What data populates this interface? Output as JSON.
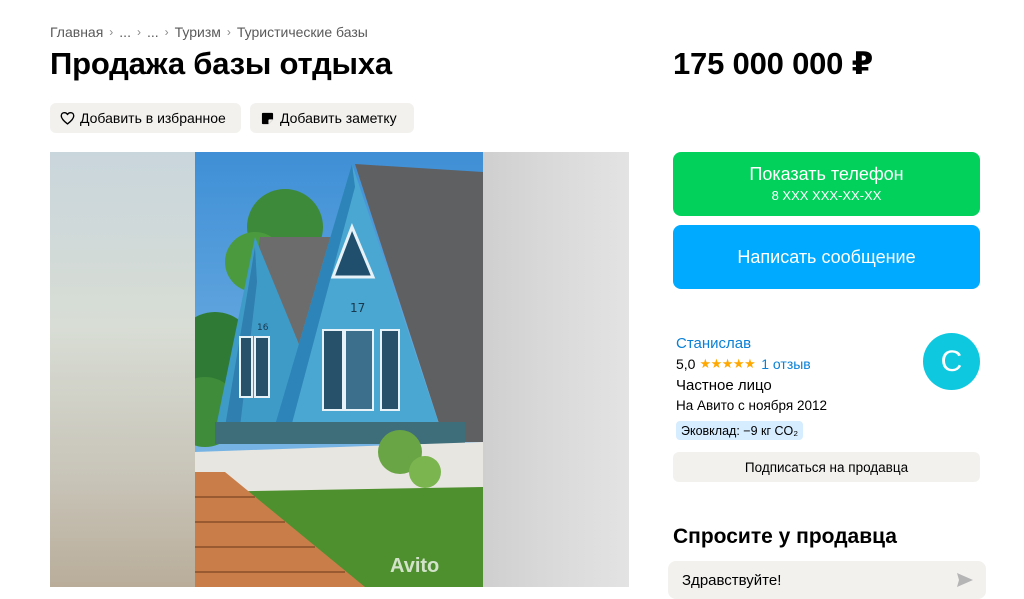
{
  "breadcrumb": [
    "Главная",
    "...",
    "...",
    "Туризм",
    "Туристические базы"
  ],
  "listing": {
    "title": "Продажа базы отдыха",
    "price": "175 000 000 ₽"
  },
  "actions": {
    "favorite_label": "Добавить в избранное",
    "note_label": "Добавить заметку"
  },
  "gallery": {
    "watermark": "Avito",
    "house_numbers": [
      "16",
      "17"
    ]
  },
  "contact": {
    "call_label": "Показать телефон",
    "call_sub": "8 XXX XXX-XX-XX",
    "message_label": "Написать сообщение"
  },
  "seller": {
    "name": "Станислав",
    "rating": "5,0",
    "stars": "★★★★★",
    "reviews": "1 отзыв",
    "type": "Частное лицо",
    "since": "На Авито с ноября 2012",
    "eco": "Эковклад: −9 кг CO₂",
    "avatar_letter": "С",
    "subscribe_label": "Подписаться на продавца"
  },
  "ask": {
    "title": "Спросите у продавца",
    "input_value": "Здравствуйте!"
  },
  "colors": {
    "call_green": "#02d15c",
    "message_blue": "#00aaff",
    "link_blue": "#0a80d6",
    "avatar": "#0ec8e0",
    "star": "#ffa800"
  }
}
